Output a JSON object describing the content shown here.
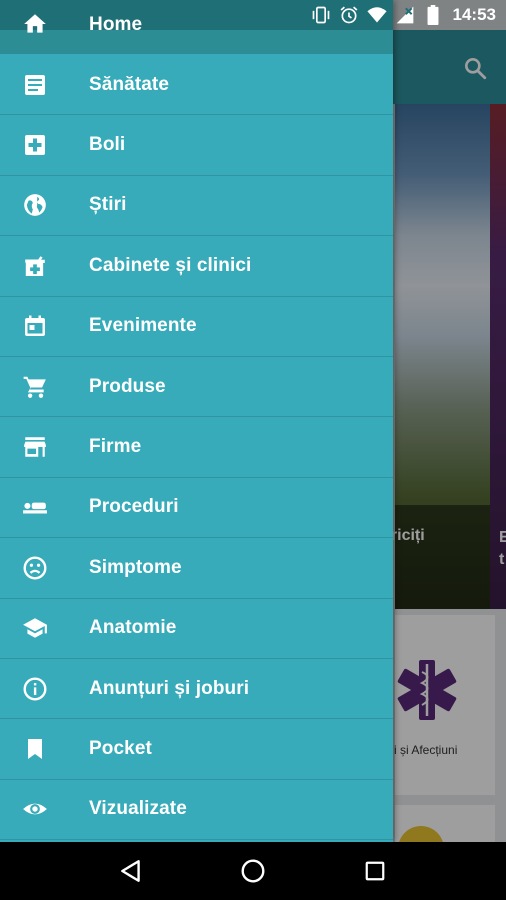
{
  "status_bar": {
    "time": "14:53",
    "icons": [
      "vibrate-icon",
      "alarm-icon",
      "wifi-icon",
      "signal-icon",
      "battery-icon"
    ]
  },
  "background": {
    "hero_caption": "ericiți",
    "hero2_caption": "E\nt",
    "card_label": "i și Afecțiuni",
    "search_icon": "search-icon"
  },
  "drawer": {
    "items": [
      {
        "label": "Home",
        "icon": "home-icon"
      },
      {
        "label": "Sănătate",
        "icon": "article-icon"
      },
      {
        "label": "Boli",
        "icon": "medical-plus-icon"
      },
      {
        "label": "Știri",
        "icon": "globe-icon"
      },
      {
        "label": "Cabinete și clinici",
        "icon": "clinic-icon"
      },
      {
        "label": "Evenimente",
        "icon": "calendar-icon"
      },
      {
        "label": "Produse",
        "icon": "cart-icon"
      },
      {
        "label": "Firme",
        "icon": "store-icon"
      },
      {
        "label": "Proceduri",
        "icon": "procedure-bed-icon"
      },
      {
        "label": "Simptome",
        "icon": "sad-face-icon"
      },
      {
        "label": "Anatomie",
        "icon": "school-icon"
      },
      {
        "label": "Anunțuri și joburi",
        "icon": "info-icon"
      },
      {
        "label": "Pocket",
        "icon": "bookmark-icon"
      },
      {
        "label": "Vizualizate",
        "icon": "eye-icon"
      }
    ]
  },
  "colors": {
    "drawer_bg": "#37abb9",
    "toolbar": "#2e8f99"
  },
  "nav_bar": {
    "buttons": [
      "back-icon",
      "home-circle-icon",
      "recents-icon"
    ]
  }
}
